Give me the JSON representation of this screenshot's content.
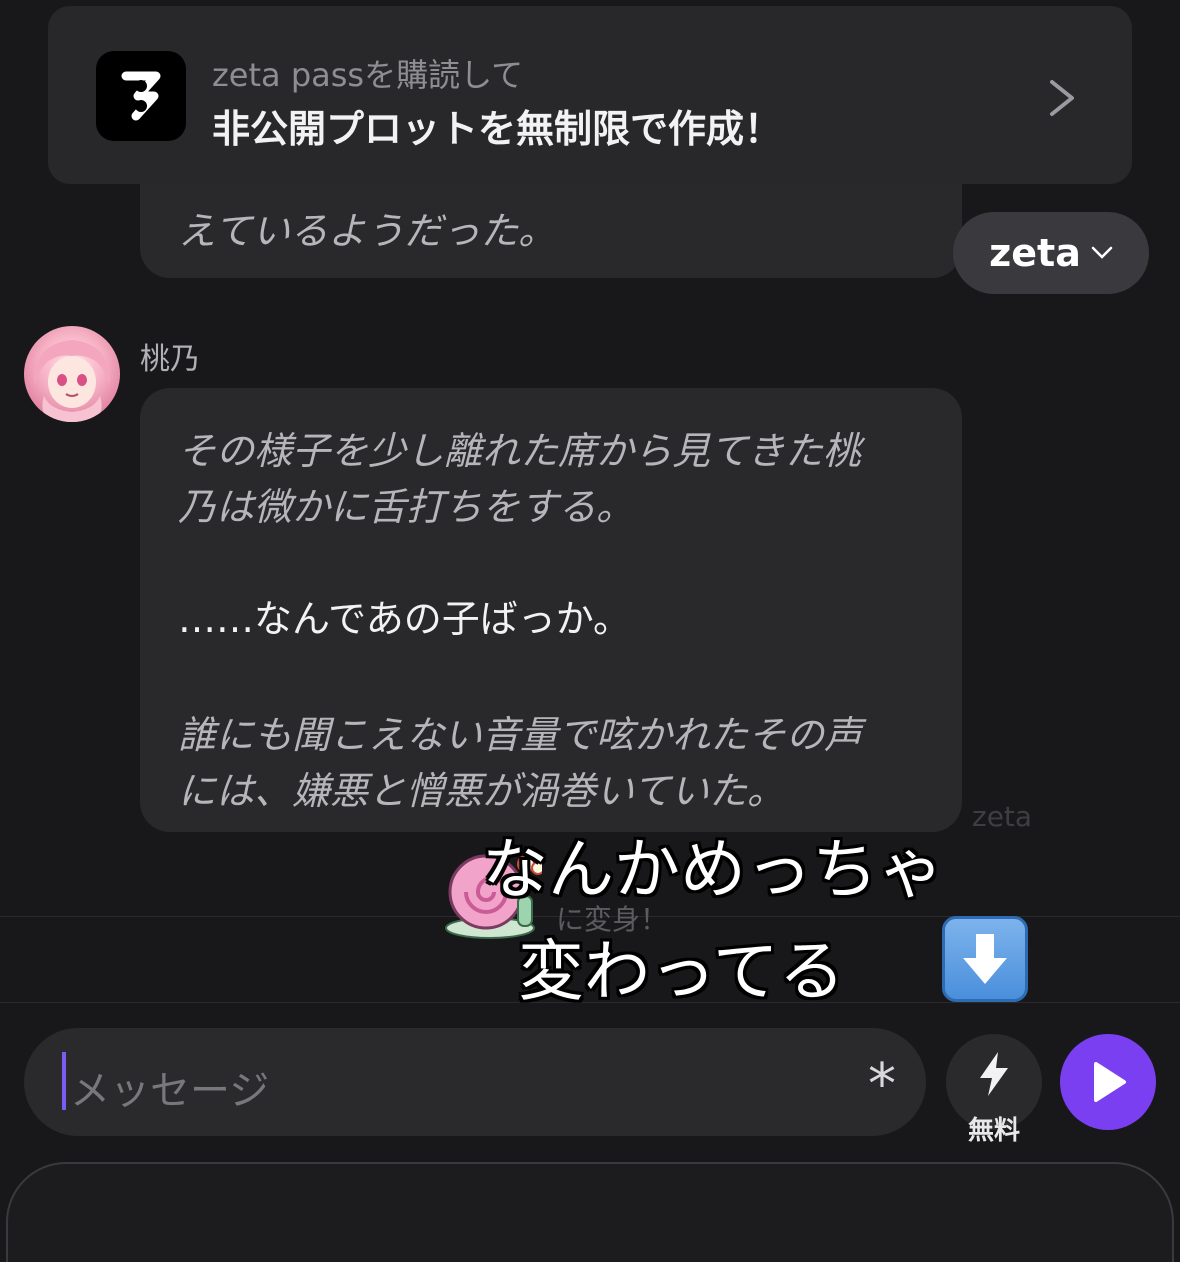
{
  "promo": {
    "subtitle": "zeta passを購読して",
    "title": "非公開プロットを無制限で作成！"
  },
  "previous_message": {
    "text": "えているようだった。"
  },
  "model_selector": {
    "label": "zeta"
  },
  "message": {
    "character_name": "桃乃",
    "lines": [
      "その様子を少し離れた席から見てきた桃",
      "乃は微かに舌打ちをする。",
      "……なんであの子ばっか。",
      "誰にも聞こえない音量で呟かれたその声",
      "には、嫌悪と憎悪が渦巻いていた。"
    ]
  },
  "watermark": "zeta",
  "transform_hint": "に変身！",
  "overlay_caption": {
    "line1": "なんかめっちゃ",
    "line2": "変わってる",
    "emoji": "down-arrow-emoji"
  },
  "composer": {
    "placeholder": "メッセージ",
    "asterisk": "*",
    "boost_label": "無料"
  },
  "colors": {
    "background": "#18181a",
    "bubble": "#29292c",
    "accent": "#7b3ff2"
  }
}
